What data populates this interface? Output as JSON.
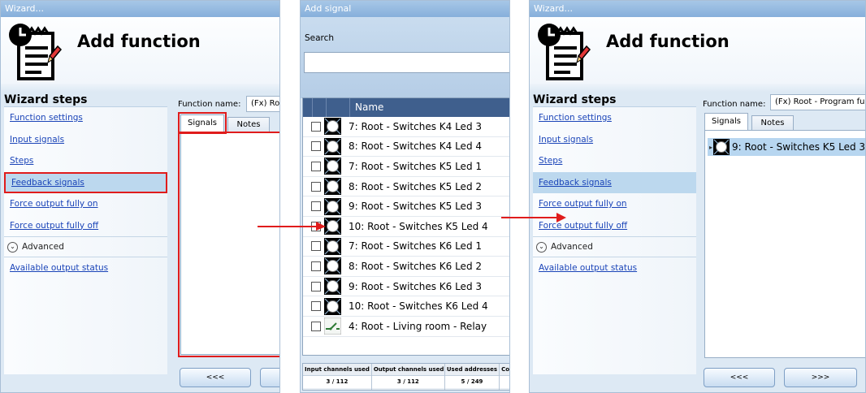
{
  "left_wizard": {
    "window_title": "Wizard...",
    "heading": "Add function",
    "steps_title": "Wizard steps",
    "steps": [
      {
        "label": "Function settings"
      },
      {
        "label": "Input signals"
      },
      {
        "label": "Steps"
      },
      {
        "label": "Feedback signals"
      },
      {
        "label": "Force output fully on"
      },
      {
        "label": "Force output fully off"
      }
    ],
    "advanced_label": "Advanced",
    "extra_step": "Available output status",
    "function_name_label": "Function name:",
    "function_name_value": "(Fx) Ro",
    "tabs": [
      "Signals",
      "Notes"
    ],
    "prev_button": "<<<"
  },
  "add_signal": {
    "window_title": "Add signal",
    "search_label": "Search",
    "search_value": "",
    "column_name": "Name",
    "rows": [
      "7: Root - Switches K4 Led 3",
      "8: Root - Switches K4 Led 4",
      "7: Root - Switches K5 Led 1",
      "8: Root - Switches K5 Led 2",
      "9: Root - Switches K5 Led 3",
      "10: Root - Switches K5 Led 4",
      "7: Root - Switches K6 Led 1",
      "8: Root - Switches K6 Led 2",
      "9: Root - Switches K6 Led 3",
      "10: Root - Switches K6 Led 4",
      "4: Root - Living room - Relay"
    ],
    "stats": [
      {
        "label": "Input channels used",
        "value": "3 / 112"
      },
      {
        "label": "Output channels used",
        "value": "3 / 112"
      },
      {
        "label": "Used addresses",
        "value": "5 / 249"
      },
      {
        "label": "Co",
        "value": ""
      }
    ]
  },
  "right_wizard": {
    "window_title": "Wizard...",
    "heading": "Add function",
    "steps_title": "Wizard steps",
    "steps": [
      {
        "label": "Function settings"
      },
      {
        "label": "Input signals"
      },
      {
        "label": "Steps"
      },
      {
        "label": "Feedback signals"
      },
      {
        "label": "Force output fully on"
      },
      {
        "label": "Force output fully off"
      }
    ],
    "advanced_label": "Advanced",
    "extra_step": "Available output status",
    "function_name_label": "Function name:",
    "function_name_value": "(Fx) Root - Program fu",
    "tabs": [
      "Signals",
      "Notes"
    ],
    "selected_signal": "9: Root - Switches K5 Led 3",
    "prev_button": "<<<",
    "next_button": ">>>"
  },
  "colors": {
    "highlight_box": "#e01c1c",
    "link": "#1a44b8",
    "grid_header": "#3f5f8d",
    "active_step": "#bcd8ee"
  },
  "icons": {
    "function": "notepad-clock-icon",
    "signal": "led-signal-icon",
    "relay": "relay-signal-icon",
    "advanced": "chevron-down-circle-icon"
  }
}
